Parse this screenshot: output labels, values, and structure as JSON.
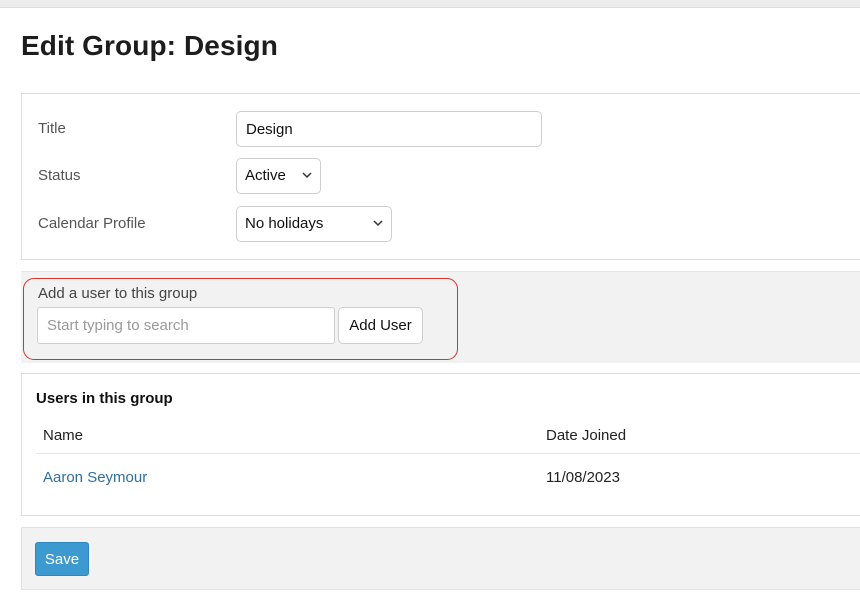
{
  "page": {
    "title": "Edit Group: Design"
  },
  "form": {
    "title_label": "Title",
    "title_value": "Design",
    "status_label": "Status",
    "status_value": "Active",
    "calendar_label": "Calendar Profile",
    "calendar_value": "No holidays"
  },
  "add_user": {
    "label": "Add a user to this group",
    "placeholder": "Start typing to search",
    "value": "",
    "button_label": "Add User",
    "highlight_color": "#d9322b"
  },
  "users": {
    "heading": "Users in this group",
    "columns": [
      "Name",
      "Date Joined"
    ],
    "rows": [
      {
        "name": "Aaron Seymour",
        "date_joined": "11/08/2023"
      }
    ],
    "link_color": "#2f6e9e"
  },
  "footer": {
    "save_label": "Save",
    "save_color": "#3d9ad1"
  },
  "icons": {
    "select_chevron": "chevron-down-icon"
  }
}
